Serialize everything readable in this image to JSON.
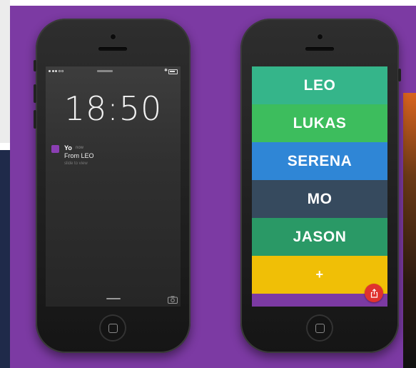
{
  "lock_screen": {
    "time": "18:50",
    "notification": {
      "app": "Yo",
      "when": "now",
      "message": "From LEO",
      "hint": "slide to view"
    }
  },
  "yo_app": {
    "contacts": [
      {
        "name": "LEO",
        "color": "#35b58a"
      },
      {
        "name": "LUKAS",
        "color": "#3dbd5d"
      },
      {
        "name": "SERENA",
        "color": "#2f86d6"
      },
      {
        "name": "MO",
        "color": "#364a5e"
      },
      {
        "name": "JASON",
        "color": "#2a9966"
      }
    ],
    "add_label": "+",
    "add_color": "#f0bf06"
  },
  "icons": [
    "camera-icon",
    "share-icon",
    "bluetooth-icon",
    "battery-icon"
  ]
}
